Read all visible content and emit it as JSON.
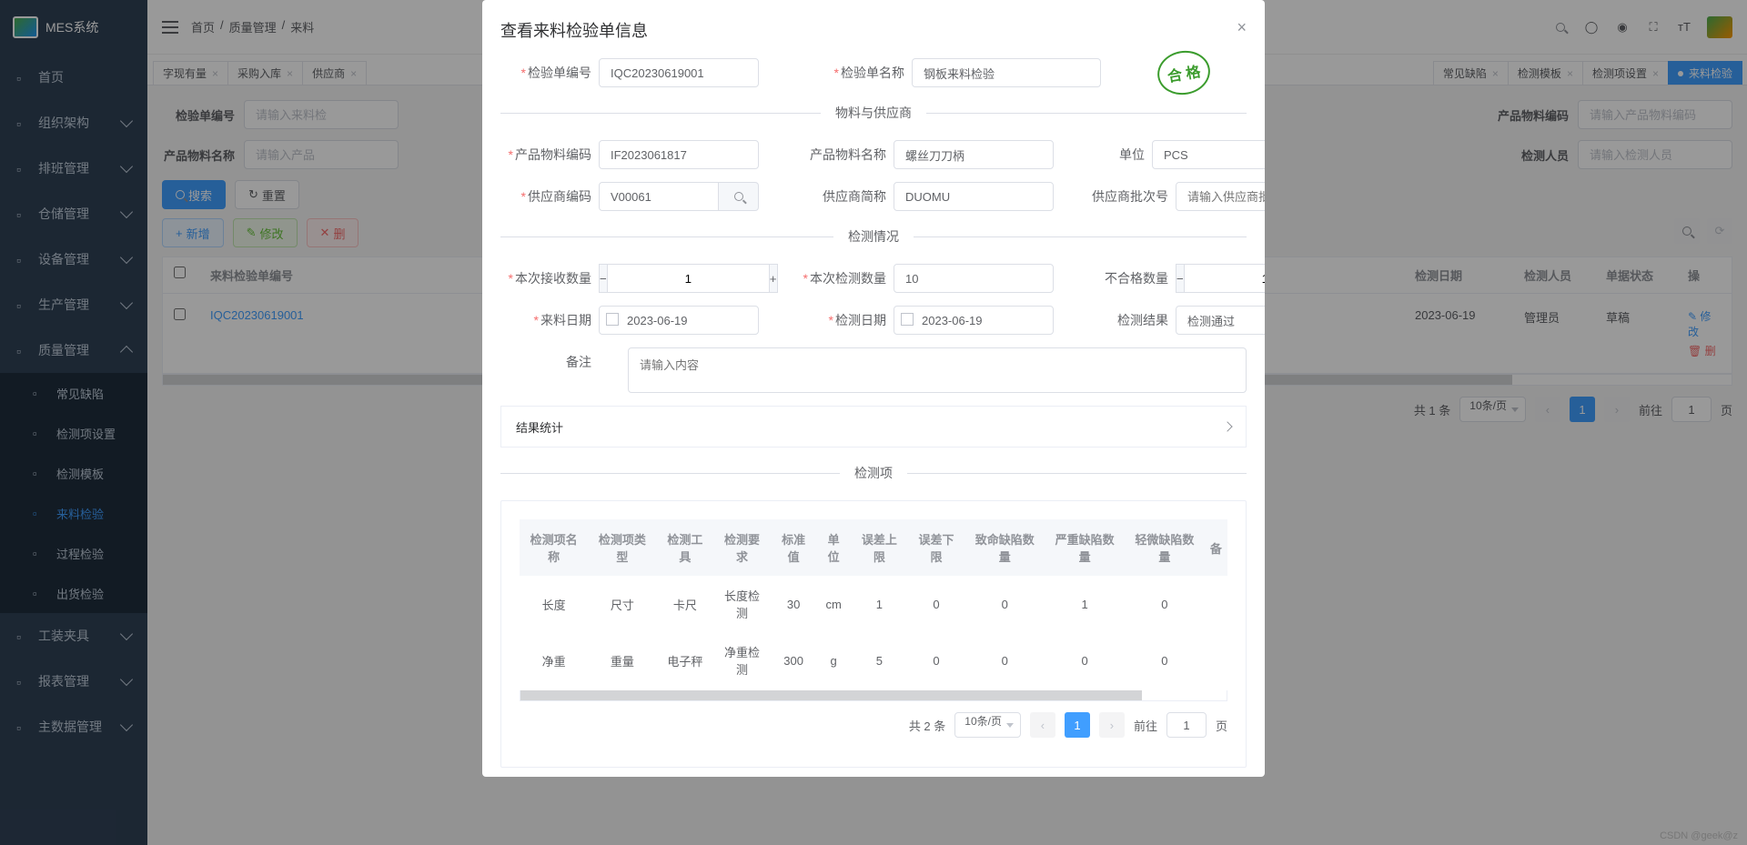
{
  "app_title": "MES系统",
  "breadcrumb": [
    "首页",
    "质量管理",
    "来料"
  ],
  "topbar_icons": [
    "search",
    "github",
    "person",
    "fullscreen",
    "font-size"
  ],
  "tabs_left": [
    "字现有量",
    "采购入库",
    "供应商"
  ],
  "tabs_right": [
    "常见缺陷",
    "检测模板",
    "检测项设置"
  ],
  "active_tab": "来料检验",
  "tab_close": "×",
  "sidebar": [
    {
      "label": "首页",
      "icon": "home"
    },
    {
      "label": "组织架构",
      "icon": "org",
      "expand": true
    },
    {
      "label": "排班管理",
      "icon": "users",
      "expand": true
    },
    {
      "label": "仓储管理",
      "icon": "wh",
      "expand": true
    },
    {
      "label": "设备管理",
      "icon": "dev",
      "expand": true
    },
    {
      "label": "生产管理",
      "icon": "prod",
      "expand": true
    },
    {
      "label": "质量管理",
      "icon": "qc",
      "expand": true,
      "open": true,
      "children": [
        {
          "label": "常见缺陷",
          "icon": "star"
        },
        {
          "label": "检测项设置",
          "icon": "check"
        },
        {
          "label": "检测模板",
          "icon": "gear"
        },
        {
          "label": "来料检验",
          "icon": "edit",
          "active": true
        },
        {
          "label": "过程检验",
          "icon": "note"
        },
        {
          "label": "出货检验",
          "icon": "plane"
        }
      ]
    },
    {
      "label": "工装夹具",
      "icon": "lock",
      "expand": true
    },
    {
      "label": "报表管理",
      "icon": "chart",
      "expand": true
    },
    {
      "label": "主数据管理",
      "icon": "data",
      "expand": true
    }
  ],
  "search_fields": {
    "inspect_no_label": "检验单编号",
    "inspect_no_ph": "请输入来料检",
    "item_code_label": "产品物料编码",
    "item_code_ph": "请输入产品物料编码",
    "item_name_label": "产品物料名称",
    "item_name_ph": "请输入产品",
    "inspector_label": "检测人员",
    "inspector_ph": "请输入检测人员"
  },
  "btns": {
    "search": "搜索",
    "reset": "重置",
    "add": "新增",
    "edit": "修改",
    "del": "删",
    "refresh": "⟳"
  },
  "grid": {
    "headers": {
      "inspect_no": "来料检验单编号",
      "date": "检测日期",
      "inspector": "检测人员",
      "status": "单据状态",
      "op": "操"
    },
    "row": {
      "inspect_no": "IQC20230619001",
      "date": "2023-06-19",
      "inspector": "管理员",
      "status": "草稿",
      "op_edit": "✎ 修改",
      "op_del": "🗑 删"
    }
  },
  "pager": {
    "total": "共 1 条",
    "size": "10条/页",
    "page": "1",
    "goto": "前往",
    "goto_tail": "页"
  },
  "dialog": {
    "title": "查看来料检验单信息",
    "stamp": "合 格",
    "inspect_no_label": "检验单编号",
    "inspect_no": "IQC20230619001",
    "inspect_name_label": "检验单名称",
    "inspect_name": "钢板来料检验",
    "section_material": "物料与供应商",
    "item_code_label": "产品物料编码",
    "item_code": "IF2023061817",
    "item_name_label": "产品物料名称",
    "item_name": "螺丝刀刀柄",
    "unit_label": "单位",
    "unit": "PCS",
    "vendor_code_label": "供应商编码",
    "vendor_code": "V00061",
    "vendor_short_label": "供应商简称",
    "vendor_short": "DUOMU",
    "vendor_lot_label": "供应商批次号",
    "vendor_lot_ph": "请输入供应商批次号",
    "section_check": "检测情况",
    "recv_qty_label": "本次接收数量",
    "recv_qty": "1",
    "check_qty_label": "本次检测数量",
    "check_qty": "10",
    "ng_qty_label": "不合格数量",
    "ng_qty": "1",
    "in_date_label": "来料日期",
    "in_date": "2023-06-19",
    "check_date_label": "检测日期",
    "check_date": "2023-06-19",
    "result_label": "检测结果",
    "result": "检测通过",
    "remark_label": "备注",
    "remark_ph": "请输入内容",
    "stats": "结果统计",
    "section_items": "检测项",
    "item_headers": [
      "检测项名称",
      "检测项类型",
      "检测工具",
      "检测要求",
      "标准值",
      "单位",
      "误差上限",
      "误差下限",
      "致命缺陷数量",
      "严重缺陷数量",
      "轻微缺陷数量",
      "备"
    ],
    "item_rows": [
      {
        "name": "长度",
        "type": "尺寸",
        "tool": "卡尺",
        "req": "长度检测",
        "std": "30",
        "unit": "cm",
        "ul": "1",
        "ll": "0",
        "cr": "0",
        "maj": "1",
        "min": "0"
      },
      {
        "name": "净重",
        "type": "重量",
        "tool": "电子秤",
        "req": "净重检测",
        "std": "300",
        "unit": "g",
        "ul": "5",
        "ll": "0",
        "cr": "0",
        "maj": "0",
        "min": "0"
      }
    ],
    "item_pager": {
      "total": "共 2 条",
      "size": "10条/页",
      "page": "1",
      "goto": "前往",
      "goto_tail": "页"
    }
  },
  "watermark": "CSDN @geek@z"
}
